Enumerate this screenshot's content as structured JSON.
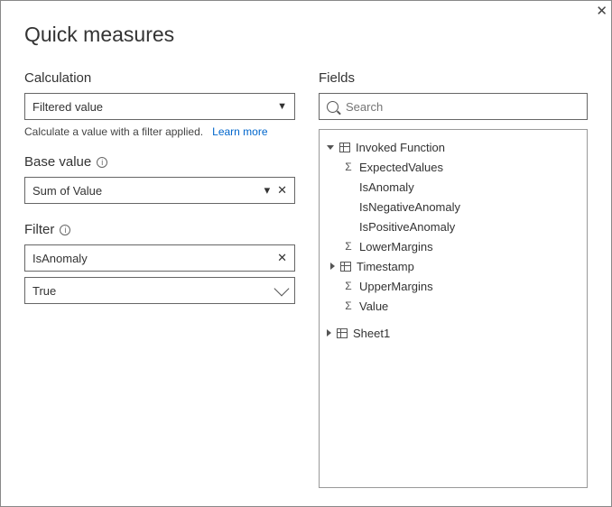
{
  "title": "Quick measures",
  "close_label": "✕",
  "left": {
    "calc_label": "Calculation",
    "calc_value": "Filtered value",
    "calc_help": "Calculate a value with a filter applied.",
    "learn_more": "Learn more",
    "base_label": "Base value",
    "base_value": "Sum of Value",
    "filter_label": "Filter",
    "filter_field": "IsAnomaly",
    "filter_value": "True"
  },
  "right": {
    "fields_label": "Fields",
    "search_placeholder": "Search",
    "tree": {
      "invoked": "Invoked Function",
      "expected": "ExpectedValues",
      "isanom": "IsAnomaly",
      "isneg": "IsNegativeAnomaly",
      "ispos": "IsPositiveAnomaly",
      "lower": "LowerMargins",
      "timestamp": "Timestamp",
      "upper": "UpperMargins",
      "value": "Value",
      "sheet1": "Sheet1"
    }
  }
}
